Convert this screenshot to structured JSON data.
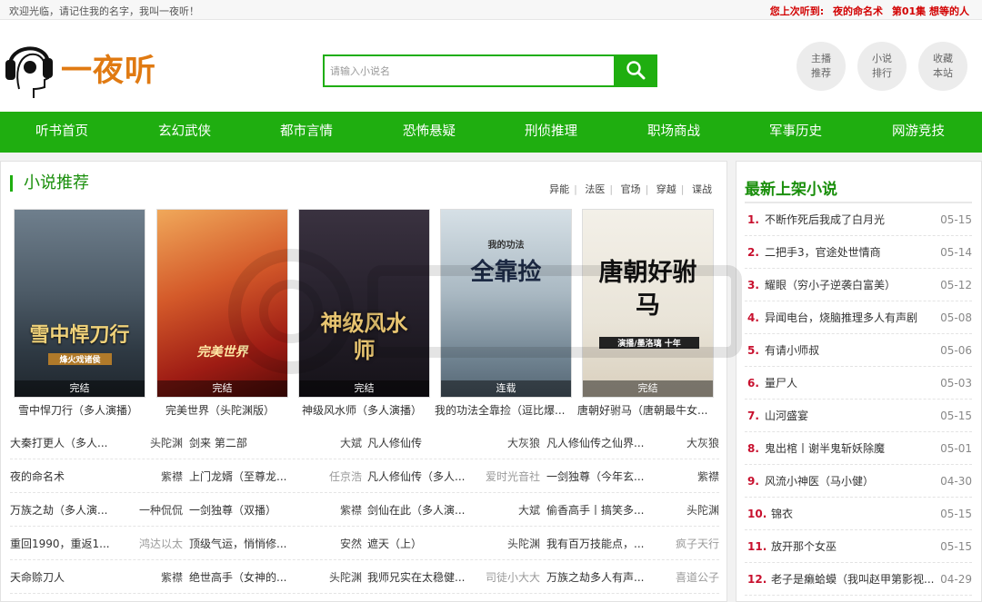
{
  "topbar": {
    "welcome": "欢迎光临，请记住我的名字，我叫一夜听！",
    "last_label": "您上次听到:",
    "last_book": "夜的命名术",
    "last_episode": "第01集 想等的人"
  },
  "logo": {
    "text": "一夜听"
  },
  "search": {
    "placeholder": "请输入小说名"
  },
  "quick": [
    {
      "line1": "主播",
      "line2": "推荐"
    },
    {
      "line1": "小说",
      "line2": "排行"
    },
    {
      "line1": "收藏",
      "line2": "本站"
    }
  ],
  "nav": [
    "听书首页",
    "玄幻武侠",
    "都市言情",
    "恐怖悬疑",
    "刑侦推理",
    "职场商战",
    "军事历史",
    "网游竞技"
  ],
  "recommend": {
    "title": "小说推荐",
    "tags": [
      "异能",
      "法医",
      "官场",
      "穿越",
      "谍战"
    ],
    "covers": [
      {
        "title": "雪中悍刀行（多人演播）",
        "status": "完结",
        "big": "雪中悍刀行",
        "sub": "烽火戏诸侯"
      },
      {
        "title": "完美世界（头陀渊版）",
        "status": "完结",
        "big": "完美世界",
        "sub": ""
      },
      {
        "title": "神级风水师（多人演播）",
        "status": "完结",
        "big": "神级风水师",
        "sub": ""
      },
      {
        "title": "我的功法全靠捡（逗比爆...",
        "status": "连载",
        "big": "全靠捡",
        "sub": "我的功法"
      },
      {
        "title": "唐朝好驸马（唐朝最牛女...",
        "status": "完结",
        "big": "唐朝好驸马",
        "sub": "演播/墨洛璃 十年"
      }
    ],
    "rows": [
      [
        [
          "大秦打更人（多人...",
          "头陀渊"
        ],
        [
          "剑来 第二部",
          "大斌"
        ],
        [
          "凡人修仙传",
          "大灰狼"
        ],
        [
          "凡人修仙传之仙界...",
          "大灰狼"
        ]
      ],
      [
        [
          "夜的命名术",
          "紫襟"
        ],
        [
          "上门龙婿（至尊龙...",
          "任京浩"
        ],
        [
          "凡人修仙传（多人...",
          "爱时光音社"
        ],
        [
          "一剑独尊（今年玄...",
          "紫襟"
        ]
      ],
      [
        [
          "万族之劫（多人演...",
          "一种侃侃"
        ],
        [
          "一剑独尊（双播）",
          "紫襟"
        ],
        [
          "剑仙在此（多人演...",
          "大斌"
        ],
        [
          "偷香高手丨搞笑多...",
          "头陀渊"
        ]
      ],
      [
        [
          "重回1990，重返1...",
          "鸿达以太"
        ],
        [
          "顶级气运，悄悄修...",
          "安然"
        ],
        [
          "遮天（上）",
          "头陀渊"
        ],
        [
          "我有百万技能点，...",
          "疯子天行"
        ]
      ],
      [
        [
          "天命赊刀人",
          "紫襟"
        ],
        [
          "绝世高手（女神的...",
          "头陀渊"
        ],
        [
          "我师兄实在太稳健...",
          "司徒小大大"
        ],
        [
          "万族之劫多人有声...",
          "喜道公子"
        ]
      ]
    ],
    "grey_authors": [
      "一种侃侃",
      "任京浩",
      "爱时光音社",
      "鸿达以太",
      "疯子天行",
      "司徒小大大",
      "喜道公子"
    ]
  },
  "latest": {
    "title": "最新上架小说",
    "items": [
      {
        "n": "1.",
        "t": "不断作死后我成了白月光",
        "d": "05-15"
      },
      {
        "n": "2.",
        "t": "二把手3，官途处世情商",
        "d": "05-14"
      },
      {
        "n": "3.",
        "t": "耀眼（穷小子逆袭白富美）",
        "d": "05-12"
      },
      {
        "n": "4.",
        "t": "异闻电台，烧脑推理多人有声剧",
        "d": "05-08"
      },
      {
        "n": "5.",
        "t": "有请小师叔",
        "d": "05-06"
      },
      {
        "n": "6.",
        "t": "量尸人",
        "d": "05-03"
      },
      {
        "n": "7.",
        "t": "山河盛宴",
        "d": "05-15"
      },
      {
        "n": "8.",
        "t": "鬼出棺丨谢半鬼斩妖除魔",
        "d": "05-01"
      },
      {
        "n": "9.",
        "t": "风流小神医（马小健）",
        "d": "04-30"
      },
      {
        "n": "10.",
        "t": "锦衣",
        "d": "05-15"
      },
      {
        "n": "11.",
        "t": "放开那个女巫",
        "d": "05-15"
      },
      {
        "n": "12.",
        "t": "老子是癞蛤蟆（我叫赵甲第影视...",
        "d": "04-29"
      }
    ]
  },
  "colors": {
    "brand": "#1fae10",
    "accent_red": "#d20000",
    "logo_orange": "#e07a12"
  }
}
